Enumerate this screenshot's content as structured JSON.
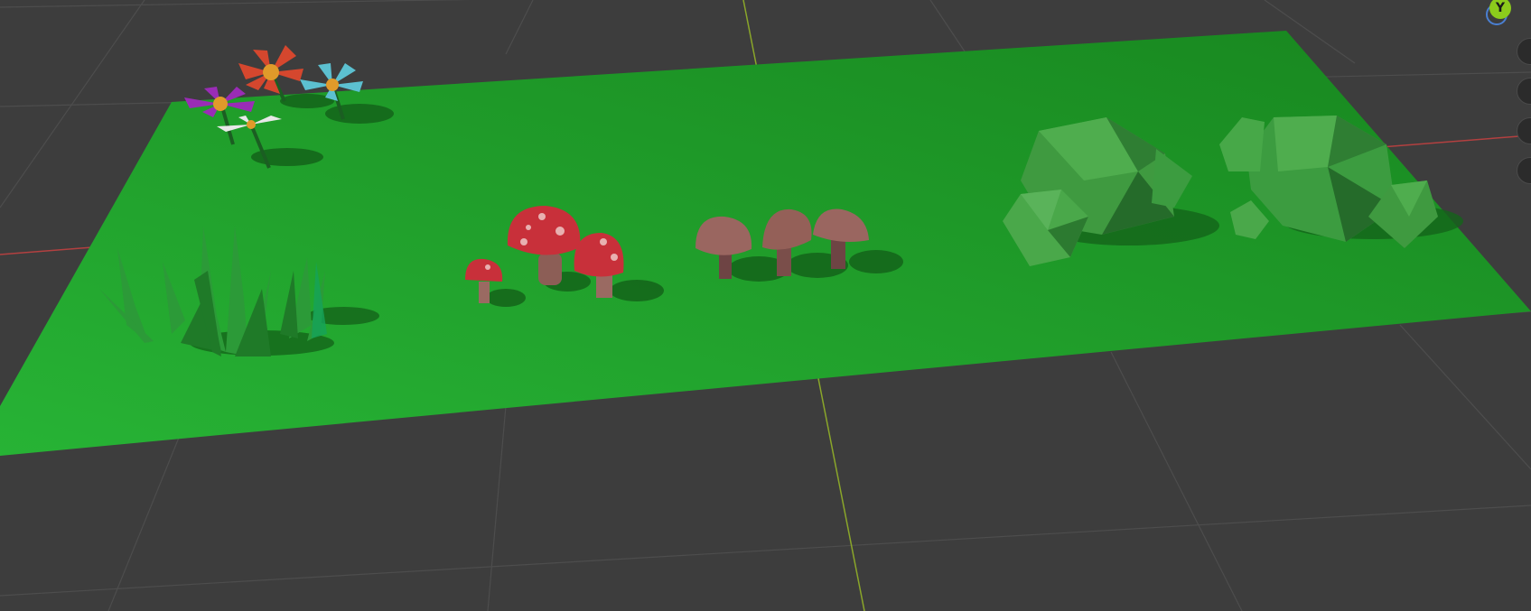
{
  "viewport": {
    "background": "#3d3d3d",
    "grid_color": "#4d4d4d",
    "x_axis_color": "#b34040",
    "y_axis_color": "#8aa62a"
  },
  "gizmo": {
    "y_label": "Y",
    "y_color": "#8ccb1c",
    "x_color": "#4a7fd1"
  },
  "scene": {
    "ground_color": "#1f9a2a",
    "objects": [
      "flowers",
      "grass",
      "red-mushrooms",
      "brown-mushrooms",
      "rock-left",
      "rock-right"
    ],
    "flower_colors": {
      "red": "#d5472e",
      "blue": "#5cc0d0",
      "purple": "#9a2cb6",
      "white": "#e8e8e8",
      "center": "#e09a2a"
    },
    "mushroom_red": "#c8303a",
    "mushroom_brown": "#9a6660",
    "rock_green": "#3f9a40"
  }
}
